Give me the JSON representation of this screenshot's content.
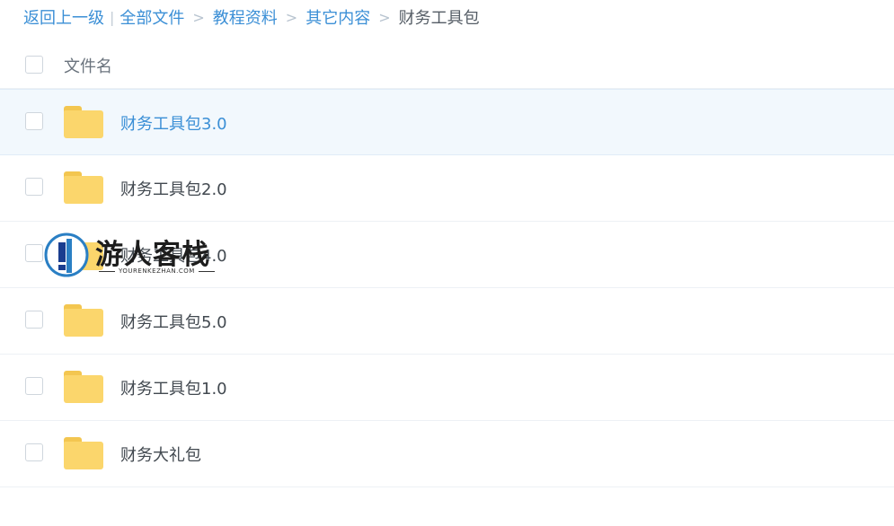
{
  "breadcrumb": {
    "back": "返回上一级",
    "separator_bar": "|",
    "separator": ">",
    "items": [
      "全部文件",
      "教程资料",
      "其它内容"
    ],
    "current": "财务工具包"
  },
  "header": {
    "column_name": "文件名"
  },
  "files": [
    {
      "name": "财务工具包3.0",
      "active": true
    },
    {
      "name": "财务工具包2.0",
      "active": false
    },
    {
      "name": "财务工具包4.0",
      "active": false
    },
    {
      "name": "财务工具包5.0",
      "active": false
    },
    {
      "name": "财务工具包1.0",
      "active": false
    },
    {
      "name": "财务大礼包",
      "active": false
    }
  ],
  "watermark": {
    "title": "游人客栈",
    "subtitle": "YOURENKEZHAN.COM"
  },
  "icons": {
    "folder": "folder-icon",
    "checkbox": "checkbox-icon"
  },
  "colors": {
    "link": "#3b8fd6",
    "folder": "#fbd66c",
    "active_row": "#f2f8fd"
  }
}
